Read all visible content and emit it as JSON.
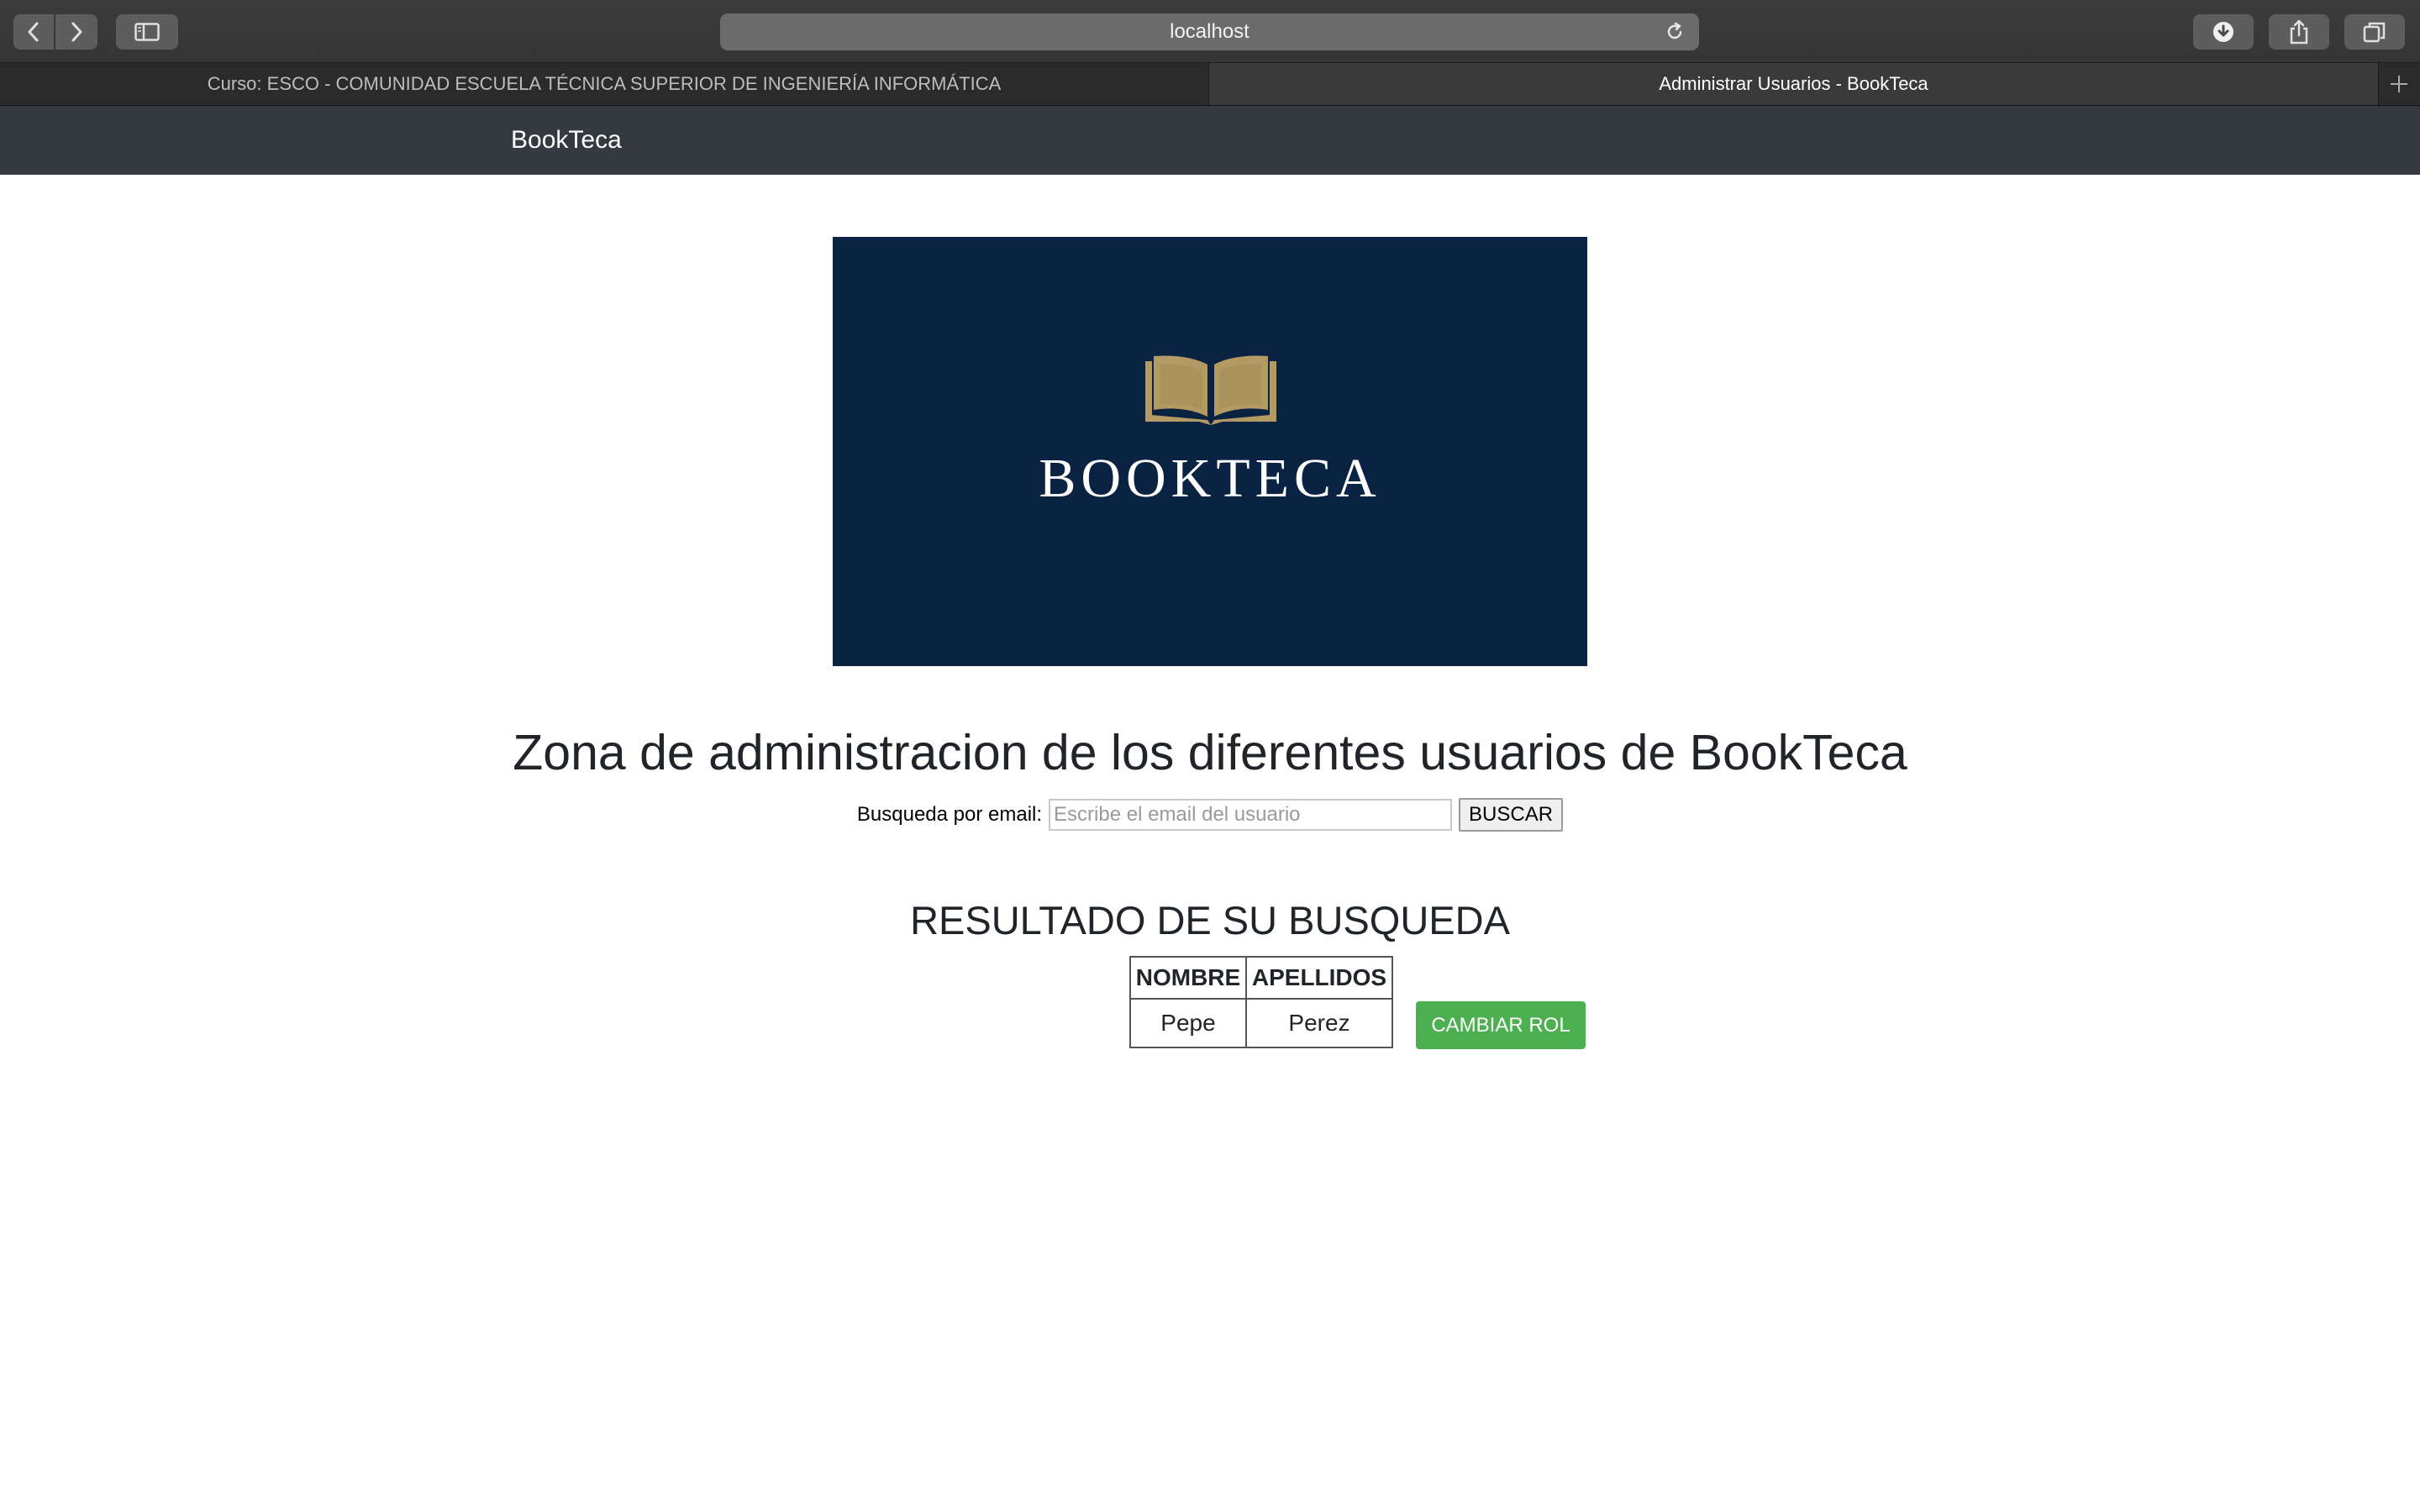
{
  "browser": {
    "url": "localhost",
    "tabs": [
      {
        "label": "Curso: ESCO - COMUNIDAD ESCUELA TÉCNICA SUPERIOR DE INGENIERÍA INFORMÁTICA",
        "active": false
      },
      {
        "label": "Administrar Usuarios - BookTeca",
        "active": true
      }
    ],
    "icons": {
      "back": "chevron-left-icon",
      "forward": "chevron-right-icon",
      "sidebar": "sidebar-icon",
      "reload": "reload-icon",
      "downloads": "download-icon",
      "share": "share-icon",
      "tabs_overview": "tabs-icon",
      "new_tab": "plus-icon"
    }
  },
  "navbar": {
    "brand": "BookTeca"
  },
  "logo": {
    "text": "BOOKTECA",
    "background": "#0a2342",
    "book_color": "#b39a62"
  },
  "main": {
    "heading": "Zona de administracion de los diferentes usuarios de BookTeca",
    "search": {
      "label": "Busqueda por email:",
      "placeholder": "Escribe el email del usuario",
      "value": "",
      "button": "BUSCAR"
    },
    "results": {
      "title": "RESULTADO DE SU BUSQUEDA",
      "columns": [
        "NOMBRE",
        "APELLIDOS"
      ],
      "rows": [
        {
          "nombre": "Pepe",
          "apellidos": "Perez",
          "action": "CAMBIAR ROL"
        }
      ]
    }
  },
  "colors": {
    "navbar": "#343a40",
    "action_button": "#4caf50",
    "text": "#212529"
  }
}
